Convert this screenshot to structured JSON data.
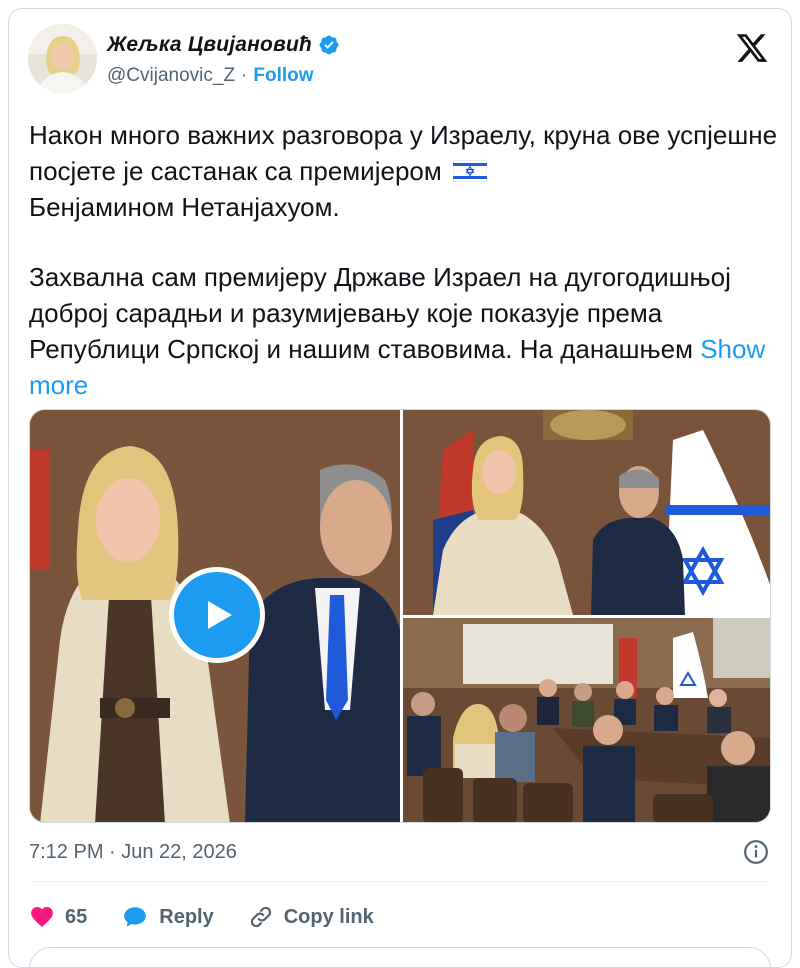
{
  "post": {
    "author": {
      "display_name": "Жељка Цвијановић",
      "handle": "@Cvijanovic_Z",
      "separator": "·",
      "follow_label": "Follow",
      "verified": true
    },
    "platform_icon": "x-logo-icon",
    "text": {
      "paragraph1": "Након много важних разговора у Израелу, круна ове успјешне посјете је састанак са премијером",
      "paragraph1_end": "Бенјамином Нетанјахуом.",
      "paragraph2": "Захвална сам премијеру Државе Израел на дугогодишњој доброј сарадњи и разумијевању које показује према Републици Српској и нашим ставовима. На данашњем",
      "show_more": "Show more"
    },
    "timestamp": "7:12 PM · Jun 22, 2026",
    "actions": {
      "like_count": "65",
      "reply_label": "Reply",
      "copy_link_label": "Copy link"
    }
  },
  "colors": {
    "accent": "#1d9bf0",
    "like": "#f91880",
    "secondary_text": "#536471",
    "border": "#cfd9de"
  }
}
